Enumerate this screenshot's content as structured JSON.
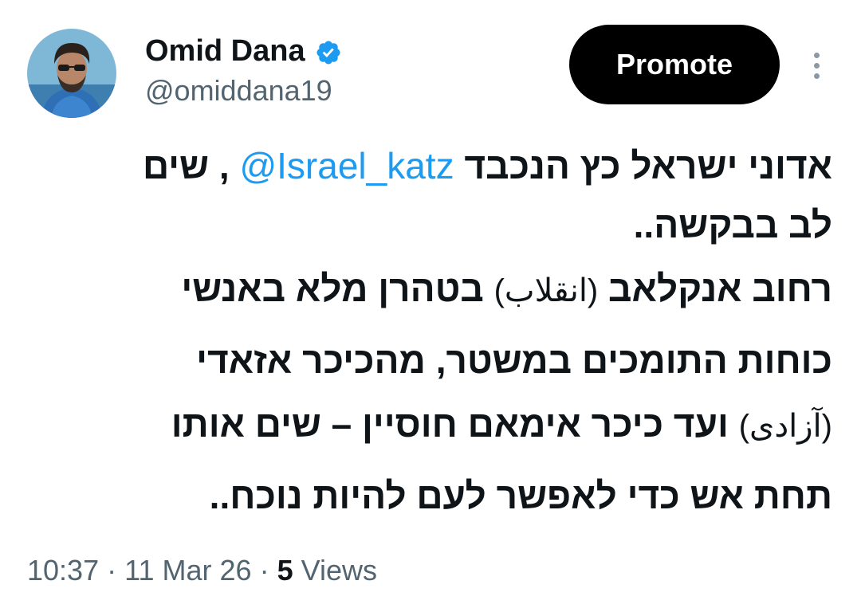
{
  "author": {
    "name": "Omid Dana",
    "handle": "@omiddana19",
    "verified": true,
    "avatar": "profile-photo"
  },
  "promote_button": {
    "label": "Promote"
  },
  "more_menu": {
    "icon": "vertical-ellipsis-icon"
  },
  "tweet": {
    "lines": [
      {
        "before": "אדוני ישראל כץ הנכבד ",
        "mention": "@Israel_katz",
        "after": " , שים"
      },
      {
        "text": "לב בבקשה.."
      },
      {
        "before": "רחוב אנקלאב ",
        "aside": "(انقلاب)",
        "after": " בטהרן מלא באנשי"
      },
      {
        "text": "כוחות התומכים במשטר, מהכיכר אזאדי"
      },
      {
        "before": "",
        "aside": "(آزادی)",
        "after": " ועד כיכר אימאם חוסיין – שים אותו"
      },
      {
        "text": "תחת אש כדי לאפשר לעם להיות נוכח.."
      }
    ]
  },
  "meta": {
    "time": "10:37",
    "separator": "·",
    "date": "11 Mar 26",
    "views_count": "5",
    "views_label": "Views"
  },
  "colors": {
    "link": "#1d9bf0",
    "secondary_text": "#536471",
    "verified_badge": "#1d9bf0",
    "button_bg": "#000000"
  }
}
